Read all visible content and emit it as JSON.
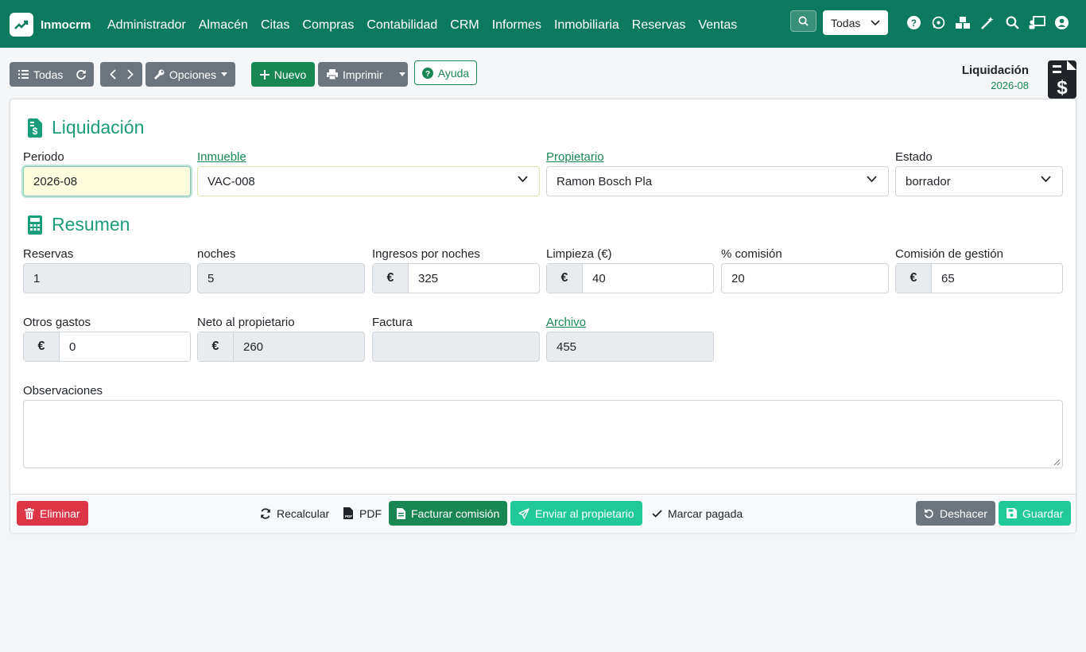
{
  "app": {
    "name": "Inmocrm"
  },
  "nav": {
    "items": [
      "Administrador",
      "Almacén",
      "Citas",
      "Compras",
      "Contabilidad",
      "CRM",
      "Informes",
      "Inmobiliaria",
      "Reservas",
      "Ventas"
    ]
  },
  "topbar": {
    "company_select": "Todas"
  },
  "toolbar": {
    "list_label": "Todas",
    "options_label": "Opciones",
    "new_label": "Nuevo",
    "print_label": "Imprimir",
    "help_label": "Ayuda"
  },
  "record": {
    "type": "Liquidación",
    "id": "2026-08"
  },
  "form": {
    "section_main": "Liquidación",
    "periodo": {
      "label": "Periodo",
      "value": "2026-08"
    },
    "inmueble": {
      "label": "Inmueble",
      "value": "VAC-008"
    },
    "propietario": {
      "label": "Propietario",
      "value": "Ramon Bosch Pla"
    },
    "estado": {
      "label": "Estado",
      "value": "borrador"
    },
    "section_summary": "Resumen",
    "reservas": {
      "label": "Reservas",
      "value": "1"
    },
    "noches": {
      "label": "noches",
      "value": "5"
    },
    "ingresos": {
      "label": "Ingresos por noches",
      "value": "325"
    },
    "limpieza": {
      "label": "Limpieza (€)",
      "value": "40"
    },
    "pct_comision": {
      "label": "% comisión",
      "value": "20"
    },
    "comision_gestion": {
      "label": "Comisión de gestión",
      "value": "65"
    },
    "otros_gastos": {
      "label": "Otros gastos",
      "value": "0"
    },
    "neto": {
      "label": "Neto al propietario",
      "value": "260"
    },
    "factura": {
      "label": "Factura",
      "value": ""
    },
    "archivo": {
      "label": "Archivo",
      "value": "455"
    },
    "observaciones": {
      "label": "Observaciones",
      "value": ""
    },
    "currency_symbol": "€"
  },
  "footer": {
    "delete_label": "Eliminar",
    "recalc_label": "Recalcular",
    "pdf_label": "PDF",
    "invoice_label": "Facturar comisión",
    "send_label": "Enviar al propietario",
    "paid_label": "Marcar pagada",
    "undo_label": "Deshacer",
    "save_label": "Guardar"
  },
  "colors": {
    "primary": "#0c7a5e",
    "success": "#198754",
    "accent": "#1a9d7b",
    "teal": "#20c997",
    "danger": "#dc3545",
    "grey": "#6c757d"
  }
}
